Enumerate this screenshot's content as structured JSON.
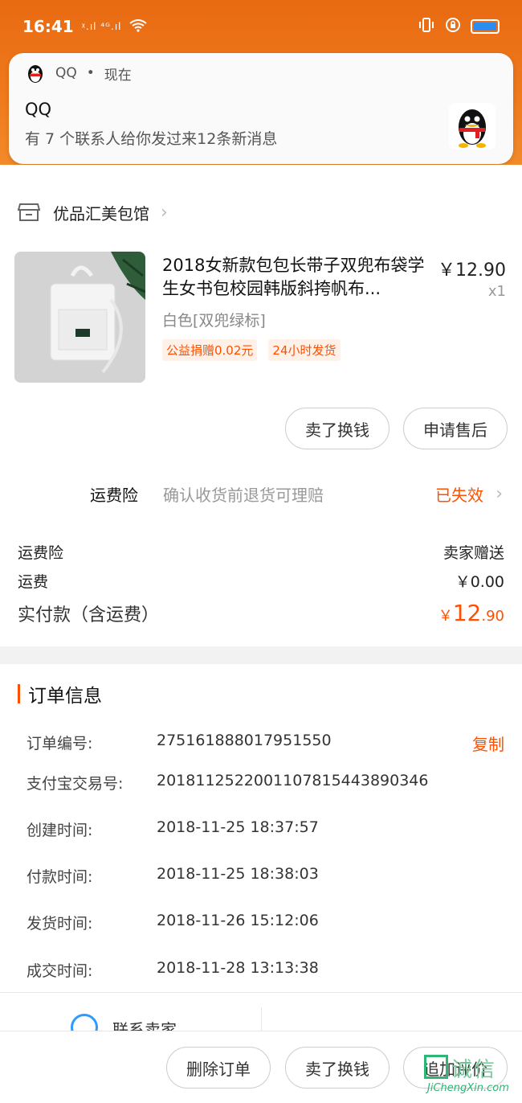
{
  "status_bar": {
    "time": "16:41",
    "signal": "ᵡ.ıl ⁴ᴳ.ıl"
  },
  "notification": {
    "app_name": "QQ",
    "when": "现在",
    "title": "QQ",
    "body": "有 7 个联系人给你发过来12条新消息"
  },
  "store": {
    "name": "优品汇美包馆"
  },
  "product": {
    "title": "2018女新款包包长带子双兜布袋学生女书包校园韩版斜挎帆布...",
    "price": "￥12.90",
    "qty": "x1",
    "sku": "白色[双兜绿标]",
    "tags": [
      "公益捐赠0.02元",
      "24小时发货"
    ]
  },
  "item_actions": {
    "sell": "卖了换钱",
    "after_sale": "申请售后"
  },
  "insurance": {
    "label": "运费险",
    "desc": "确认收货前退货可理赔",
    "status": "已失效"
  },
  "fees": {
    "ins_label": "运费险",
    "ins_value": "卖家赠送",
    "ship_label": "运费",
    "ship_value": "￥0.00",
    "total_label": "实付款（含运费）",
    "total_prefix": "￥",
    "total_int": "12",
    "total_dec": ".90"
  },
  "order_info": {
    "title": "订单信息",
    "copy": "复制",
    "rows": [
      {
        "key": "订单编号:",
        "val": "275161888017951550"
      },
      {
        "key": "支付宝交易号:",
        "val": "2018112522001107815443890346"
      },
      {
        "key": "创建时间:",
        "val": "2018-11-25 18:37:57"
      },
      {
        "key": "付款时间:",
        "val": "2018-11-25 18:38:03"
      },
      {
        "key": "发货时间:",
        "val": "2018-11-26 15:12:06"
      },
      {
        "key": "成交时间:",
        "val": "2018-11-28 13:13:38"
      }
    ]
  },
  "contact": {
    "seller": "联系卖家"
  },
  "bottom": {
    "delete": "删除订单",
    "sell": "卖了换钱",
    "review": "追加评价"
  },
  "watermark": {
    "text": "诚信",
    "sub": "JiChengXin.com"
  },
  "colors": {
    "accent": "#ff5000",
    "header": "#f07a1c"
  }
}
